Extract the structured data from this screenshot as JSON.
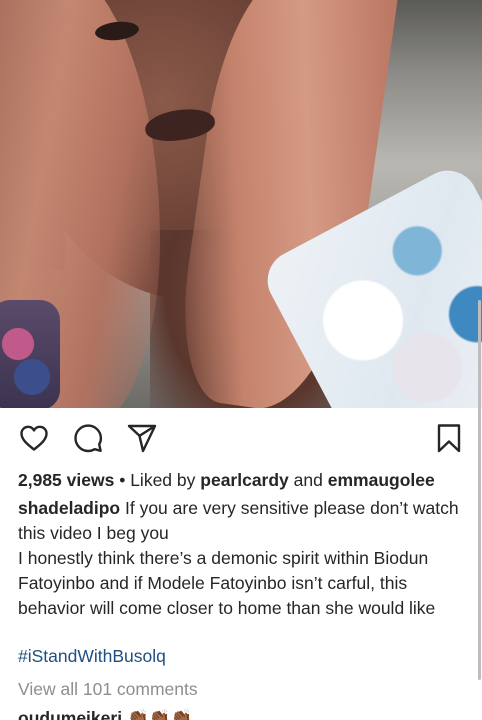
{
  "post": {
    "views_count": "2,985 views",
    "liked_by_prefix": "Liked by",
    "liked_by_user1": "pearlcardy",
    "liked_by_and": "and",
    "liked_by_user2": "emmaugolee",
    "author": "shadeladipo",
    "caption_line1": "If you are very sensitive please don’t watch this video I beg you",
    "caption_line2": "I honestly think there’s a demonic spirit within Biodun Fatoyinbo and if Modele Fatoyinbo isn’t carful, this behavior will come closer to home than she would like",
    "hashtag": "#iStandWithBusolq",
    "view_all_comments": "View all 101 comments",
    "next_comment_user": "oudumeikeri",
    "next_comment_emoji": "👏🏾👏🏾👏🏾"
  },
  "icons": {
    "like": "heart-outline-icon",
    "comment": "comment-bubble-icon",
    "share": "paper-plane-icon",
    "save": "bookmark-icon"
  },
  "colors": {
    "text": "#262626",
    "hashtag": "#1f4f80",
    "muted": "#8e8e8e"
  }
}
